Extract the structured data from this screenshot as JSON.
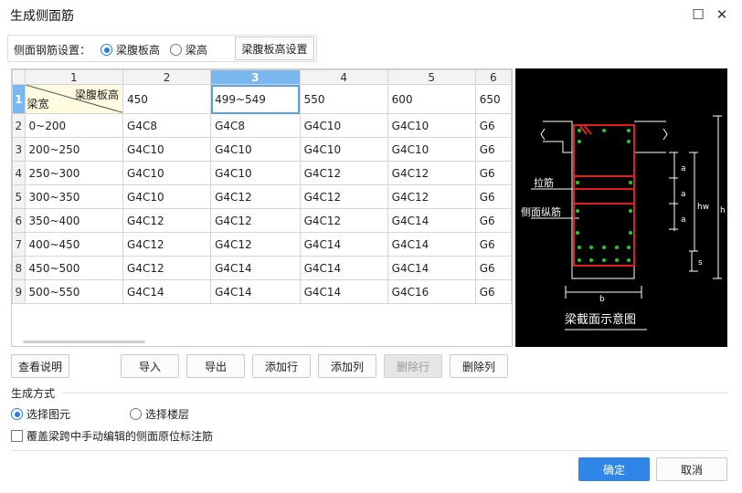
{
  "window": {
    "title": "生成侧面筋",
    "maximize_glyph": "☐",
    "close_glyph": "✕"
  },
  "setting": {
    "label": "侧面钢筋设置：",
    "options": [
      {
        "label": "梁腹板高",
        "selected": true
      },
      {
        "label": "梁高",
        "selected": false
      }
    ],
    "config_button": "梁腹板高设置"
  },
  "grid": {
    "column_numbers": [
      "1",
      "2",
      "3",
      "4",
      "5",
      "6"
    ],
    "selected_column": "3",
    "header_row": {
      "number": "1",
      "corner_top": "梁腹板高",
      "corner_bottom": "梁宽",
      "values": [
        "450",
        "499~549",
        "550",
        "600",
        "650"
      ]
    },
    "rows": [
      {
        "number": "2",
        "width": "0~200",
        "cells": [
          "G4C8",
          "G4C8",
          "G4C10",
          "G4C10",
          "G6"
        ]
      },
      {
        "number": "3",
        "width": "200~250",
        "cells": [
          "G4C10",
          "G4C10",
          "G4C10",
          "G4C10",
          "G6"
        ]
      },
      {
        "number": "4",
        "width": "250~300",
        "cells": [
          "G4C10",
          "G4C10",
          "G4C12",
          "G4C12",
          "G6"
        ]
      },
      {
        "number": "5",
        "width": "300~350",
        "cells": [
          "G4C10",
          "G4C12",
          "G4C12",
          "G4C12",
          "G6"
        ]
      },
      {
        "number": "6",
        "width": "350~400",
        "cells": [
          "G4C12",
          "G4C12",
          "G4C12",
          "G4C14",
          "G6"
        ]
      },
      {
        "number": "7",
        "width": "400~450",
        "cells": [
          "G4C12",
          "G4C12",
          "G4C14",
          "G4C14",
          "G6"
        ]
      },
      {
        "number": "8",
        "width": "450~500",
        "cells": [
          "G4C12",
          "G4C14",
          "G4C14",
          "G4C14",
          "G6"
        ]
      },
      {
        "number": "9",
        "width": "500~550",
        "cells": [
          "G4C14",
          "G4C14",
          "G4C14",
          "G4C16",
          "G6"
        ]
      }
    ]
  },
  "diagram": {
    "caption": "梁截面示意图",
    "label_tie": "拉筋",
    "label_side": "侧面纵筋",
    "dim_a": "a",
    "dim_hw": "hw",
    "dim_h": "h",
    "dim_s": "s",
    "dim_b": "b",
    "colors": {
      "background": "#000000",
      "line": "#ffffff",
      "rebar": "#e02020",
      "dot": "#22cc22"
    }
  },
  "actions": {
    "view_help": "查看说明",
    "import": "导入",
    "export": "导出",
    "add_row": "添加行",
    "add_col": "添加列",
    "delete_row": "删除行",
    "delete_col": "删除列"
  },
  "generate": {
    "title": "生成方式",
    "options": [
      {
        "label": "选择图元",
        "selected": true
      },
      {
        "label": "选择楼层",
        "selected": false
      }
    ],
    "override_label": "覆盖梁跨中手动编辑的侧面原位标注筋",
    "override_checked": false
  },
  "footer": {
    "ok": "确定",
    "cancel": "取消"
  },
  "accent": "#2f86e8"
}
